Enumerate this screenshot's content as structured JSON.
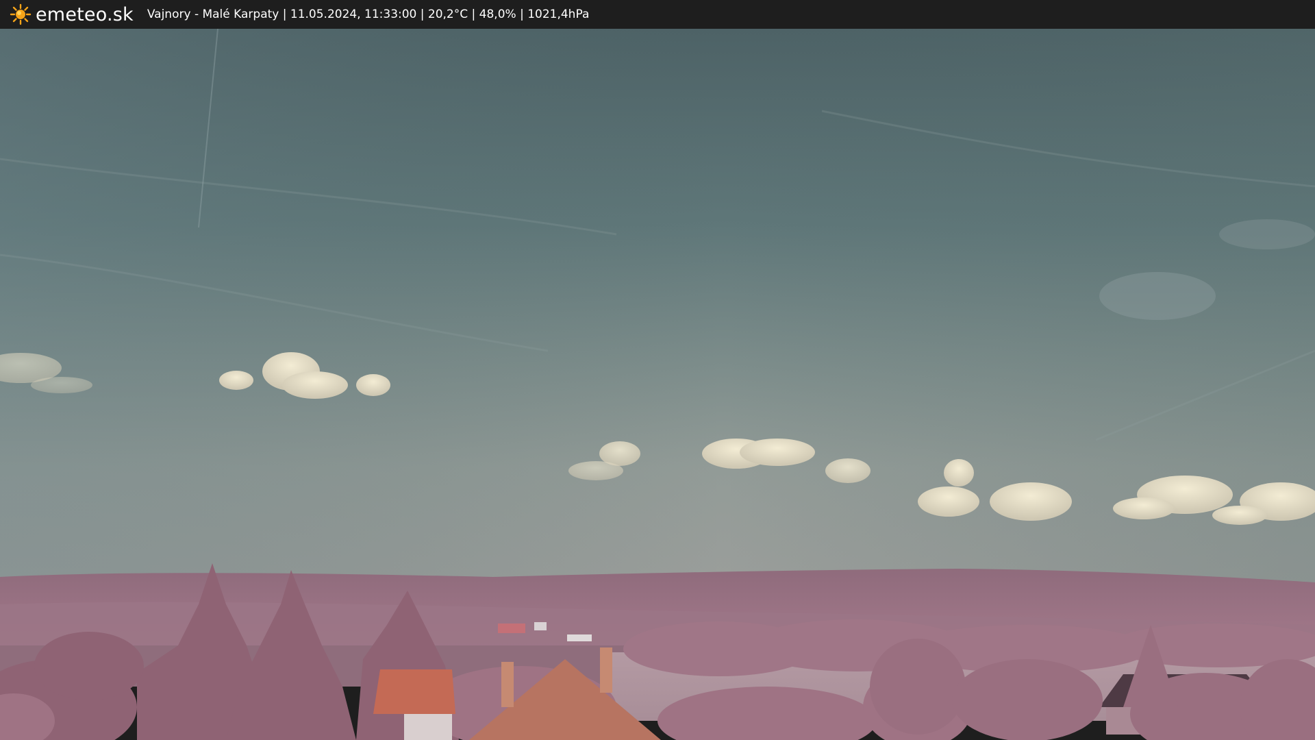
{
  "header": {
    "brand": "emeteo.sk",
    "caption": "Vajnory - Malé Karpaty | 11.05.2024, 11:33:00 | 20,2°C | 48,0% | 1021,4hPa",
    "logo_icon": "sun-icon"
  },
  "colors": {
    "bar_background": "#1e1e1e",
    "sky_top": "#4f6468",
    "sky_horizon": "#8e9995",
    "vegetation": "#a97a8c",
    "logo": "#f6a418"
  }
}
